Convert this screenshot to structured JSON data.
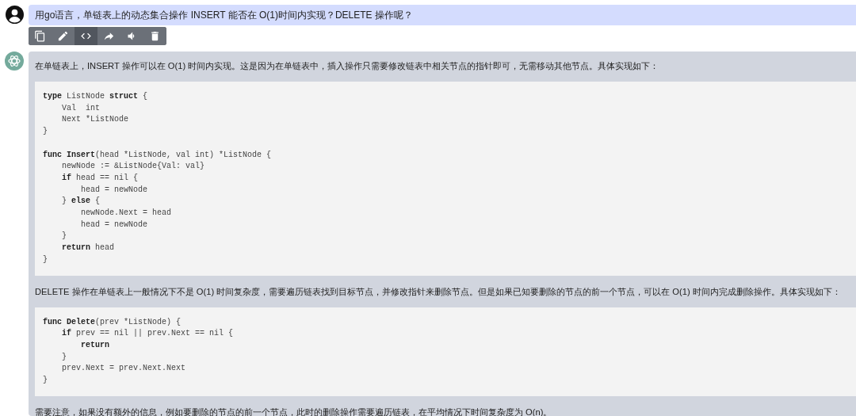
{
  "user_message": {
    "text": "用go语言，单链表上的动态集合操作 INSERT 能否在 O(1)时间内实现？DELETE 操作呢？"
  },
  "toolbar": [
    {
      "kind": "copy",
      "selected": false
    },
    {
      "kind": "edit",
      "selected": false
    },
    {
      "kind": "code",
      "selected": true
    },
    {
      "kind": "share",
      "selected": false
    },
    {
      "kind": "speak",
      "selected": false
    },
    {
      "kind": "delete",
      "selected": false
    }
  ],
  "answer": [
    {
      "kind": "text",
      "text": "在单链表上，INSERT 操作可以在 O(1) 时间内实现。这是因为在单链表中，插入操作只需要修改链表中相关节点的指针即可，无需移动其他节点。具体实现如下："
    },
    {
      "kind": "code",
      "sections": [
        [
          "**type** ListNode **struct** {",
          "    Val  int",
          "    Next *ListNode",
          "}"
        ],
        [
          "**func** **Insert**(head *ListNode, val int) *ListNode {",
          "    newNode := &ListNode{Val: val}",
          "    **if** head == nil {",
          "        head = newNode",
          "    } **else** {",
          "        newNode.Next = head",
          "        head = newNode",
          "    }",
          "    **return** head",
          "}"
        ]
      ]
    },
    {
      "kind": "text",
      "text": "DELETE 操作在单链表上一般情况下不是 O(1) 时间复杂度，需要遍历链表找到目标节点，并修改指针来删除节点。但是如果已知要删除的节点的前一个节点，可以在 O(1) 时间内完成删除操作。具体实现如下："
    },
    {
      "kind": "code",
      "sections": [
        [
          "**func** **Delete**(prev *ListNode) {",
          "    **if** prev == nil || prev.Next == nil {",
          "        **return**",
          "    }",
          "    prev.Next = prev.Next.Next",
          "}"
        ]
      ]
    },
    {
      "kind": "text",
      "text": "需要注意，如果没有额外的信息，例如要删除的节点的前一个节点，此时的删除操作需要遍历链表，在平均情况下时间复杂度为 O(n)。"
    }
  ]
}
